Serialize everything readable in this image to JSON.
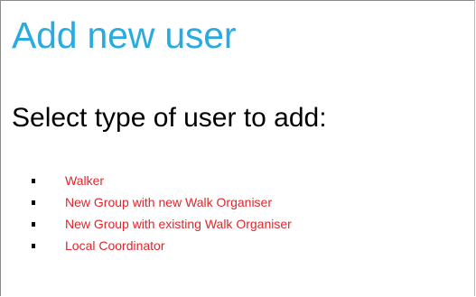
{
  "page": {
    "title": "Add new user",
    "subtitle": "Select type of user to add:"
  },
  "options": [
    {
      "label": "Walker"
    },
    {
      "label": "New Group with new Walk Organiser"
    },
    {
      "label": "New Group with existing Walk Organiser"
    },
    {
      "label": "Local Coordinator"
    }
  ],
  "colors": {
    "title": "#29abe2",
    "link": "#e0262c",
    "text": "#000000",
    "background": "#ffffff"
  }
}
